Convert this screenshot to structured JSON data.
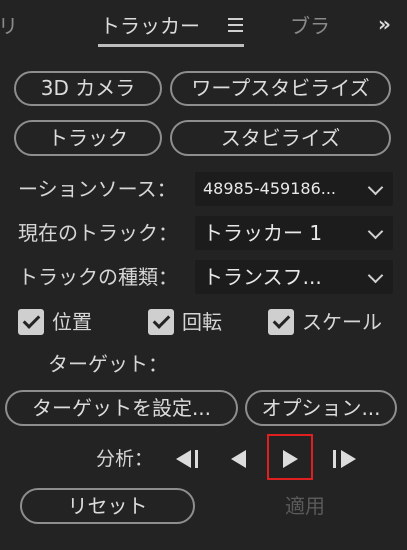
{
  "tabs": {
    "prev": "リ",
    "active": "トラッカー",
    "menu_icon": "hamburger-icon",
    "next": "ブラ",
    "overflow": "»"
  },
  "buttons": {
    "camera_3d": "3D カメラ",
    "warp_stabilize": "ワープスタビライズ",
    "track": "トラック",
    "stabilize": "スタビライズ",
    "set_target": "ターゲットを設定...",
    "options": "オプション...",
    "reset": "リセット",
    "apply": "適用"
  },
  "fields": {
    "motion_source": {
      "label": "ーションソース：",
      "value": "48985-459186..."
    },
    "current_track": {
      "label": "現在のトラック：",
      "value": "トラッカー 1"
    },
    "track_type": {
      "label": "トラックの種類：",
      "value": "トランスフ..."
    }
  },
  "checkboxes": {
    "position": {
      "label": "位置",
      "checked": true
    },
    "rotation": {
      "label": "回転",
      "checked": true
    },
    "scale": {
      "label": "スケール",
      "checked": true
    }
  },
  "target_label": "ターゲット：",
  "analyze": {
    "label": "分析：",
    "controls": [
      "step-backward-icon",
      "play-backward-icon",
      "play-forward-icon",
      "step-forward-icon"
    ]
  },
  "colors": {
    "panel_bg": "#232323",
    "highlight": "#e02020"
  }
}
